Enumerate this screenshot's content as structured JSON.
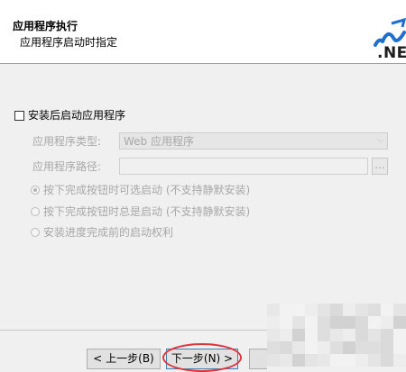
{
  "header": {
    "title": "应用程序执行",
    "subtitle": "应用程序启动时指定",
    "logo_text": ".NE"
  },
  "options": {
    "launch_checkbox_label": "安装后启动应用程序",
    "app_type_label": "应用程序类型:",
    "app_type_value": "Web 应用程序",
    "app_path_label": "应用程序路径:",
    "browse_label": "...",
    "radio_1": "按下完成按钮时可选启动 (不支持静默安装)",
    "radio_2": "按下完成按钮时总是启动 (不支持静默安装)",
    "radio_3": "安装进度完成前的启动权利"
  },
  "footer": {
    "back_label": "< 上一步(B)",
    "next_label": "下一步(N) >"
  },
  "colors": {
    "accent_highlight": "#e0343a",
    "logo_blue": "#1f6fd1"
  }
}
